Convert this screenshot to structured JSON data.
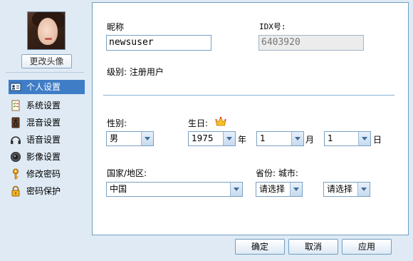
{
  "sidebar": {
    "change_avatar": "更改头像",
    "items": [
      {
        "label": "个人设置",
        "icon": "id-card-icon",
        "active": true
      },
      {
        "label": "系统设置",
        "icon": "checklist-icon"
      },
      {
        "label": "混音设置",
        "icon": "speaker-icon"
      },
      {
        "label": "语音设置",
        "icon": "headphones-icon"
      },
      {
        "label": "影像设置",
        "icon": "camera-icon"
      },
      {
        "label": "修改密码",
        "icon": "key-icon"
      },
      {
        "label": "密码保护",
        "icon": "lock-icon"
      }
    ]
  },
  "form": {
    "nickname_label": "昵称",
    "nickname_value": "newsuser",
    "idx_label": "IDX号:",
    "idx_value": "6403920",
    "level_text": "级别: 注册用户",
    "gender_label": "性别:",
    "gender_value": "男",
    "birthday_label": "生日:",
    "birth_year": "1975",
    "year_unit": "年",
    "birth_month": "1",
    "month_unit": "月",
    "birth_day": "1",
    "day_unit": "日",
    "country_label": "国家/地区:",
    "country_value": "中国",
    "province_city_label": "省份: 城市:",
    "province_value": "请选择",
    "city_value": "请选择"
  },
  "buttons": {
    "ok": "确定",
    "cancel": "取消",
    "apply": "应用"
  }
}
